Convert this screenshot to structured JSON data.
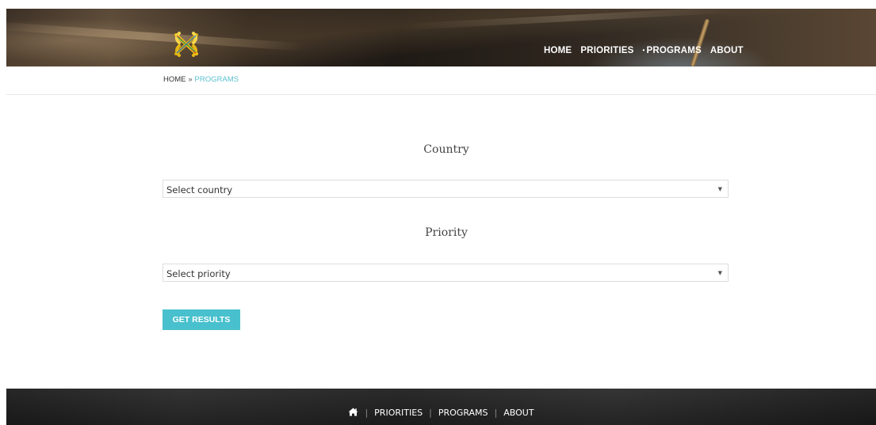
{
  "header": {
    "logo": "interlaced-ribbons-logo",
    "nav": [
      {
        "label": "HOME",
        "active": false
      },
      {
        "label": "PRIORITIES",
        "active": false
      },
      {
        "label": "PROGRAMS",
        "active": true
      },
      {
        "label": "ABOUT",
        "active": false
      }
    ],
    "active_marker": "•"
  },
  "breadcrumb": {
    "home": "HOME",
    "separator": "»",
    "current": "PROGRAMS"
  },
  "form": {
    "country_label": "Country",
    "country_select": {
      "value": "Select country",
      "icon": "dropdown-arrow-icon"
    },
    "priority_label": "Priority",
    "priority_select": {
      "value": "Select priority",
      "icon": "dropdown-arrow-icon"
    },
    "submit_label": "GET RESULTS"
  },
  "footer": {
    "home_icon": "home-icon",
    "separator": "|",
    "links": [
      "PRIORITIES",
      "PROGRAMS",
      "ABOUT"
    ]
  },
  "colors": {
    "accent": "#48c0cd",
    "breadcrumb_active": "#5bc0cf",
    "footer_bg": "#242424"
  }
}
